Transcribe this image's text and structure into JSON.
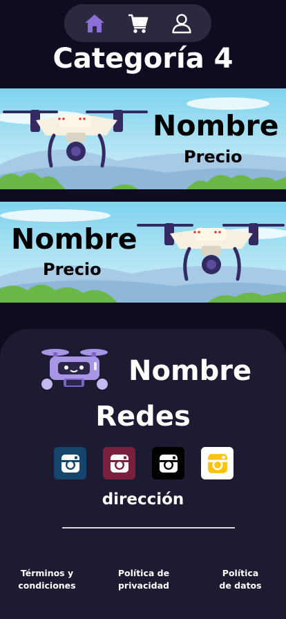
{
  "nav": {
    "items": [
      {
        "name": "home",
        "icon": "home-icon",
        "color": "#8b6fd6"
      },
      {
        "name": "cart",
        "icon": "cart-icon",
        "color": "#ffffff"
      },
      {
        "name": "profile",
        "icon": "user-icon",
        "color": "#ffffff"
      }
    ]
  },
  "page": {
    "title": "Categoría 4"
  },
  "products": [
    {
      "name": "Nombre",
      "price": "Precio"
    },
    {
      "name": "Nombre",
      "price": "Precio"
    }
  ],
  "footer": {
    "name": "Nombre",
    "social_title": "Redes",
    "socials": [
      {
        "icon": "instagram-icon",
        "bg": "#15446d"
      },
      {
        "icon": "instagram-icon",
        "bg": "#7a1f3e"
      },
      {
        "icon": "instagram-icon",
        "bg": "#000000"
      },
      {
        "icon": "instagram-icon",
        "bg": "#ffc20e"
      }
    ],
    "address": "dirección",
    "links": {
      "terms": [
        "Términos y",
        "condiciones"
      ],
      "privacy": [
        "Política de",
        "privacidad"
      ],
      "data": [
        "Política",
        "de datos"
      ]
    }
  },
  "colors": {
    "background": "#0f0c22",
    "footer": "#1d1b32",
    "accent": "#8b6fd6"
  }
}
